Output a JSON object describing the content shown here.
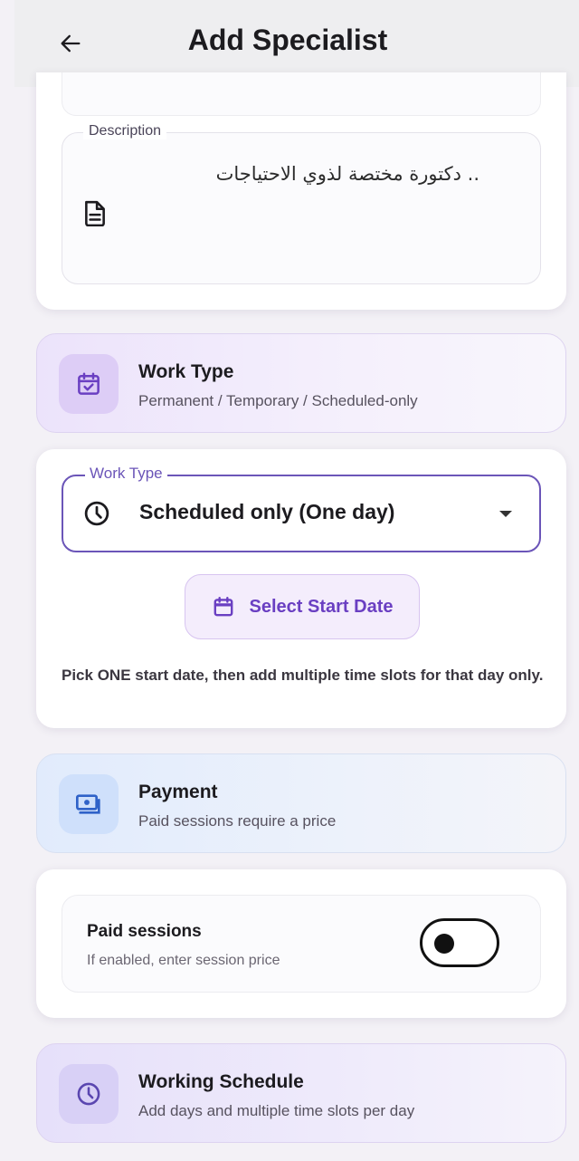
{
  "appbar": {
    "title": "Add Specialist",
    "back_icon": "arrow-left-icon"
  },
  "description": {
    "label": "Description",
    "value": ".. دكتورة مختصة لذوي الاحتياجات",
    "icon": "document-icon"
  },
  "work_type_section": {
    "title": "Work Type",
    "subtitle": "Permanent / Temporary / Scheduled-only",
    "icon": "calendar-check-icon"
  },
  "work_type_field": {
    "label": "Work Type",
    "value": "Scheduled only (One day)",
    "icon": "clock-icon",
    "select_start_date_label": "Select Start Date",
    "hint": "Pick ONE start date, then add multiple time slots for that day only."
  },
  "payment_section": {
    "title": "Payment",
    "subtitle": "Paid sessions require a price",
    "icon": "cash-icon"
  },
  "paid_sessions": {
    "title": "Paid sessions",
    "subtitle": "If enabled, enter session price",
    "enabled": false
  },
  "schedule_section": {
    "title": "Working Schedule",
    "subtitle": "Add days and multiple time slots per day",
    "icon": "clock-icon"
  },
  "colors": {
    "accent": "#6a3fc2",
    "field_border": "#6b55b8",
    "background": "#f3f1f6"
  }
}
